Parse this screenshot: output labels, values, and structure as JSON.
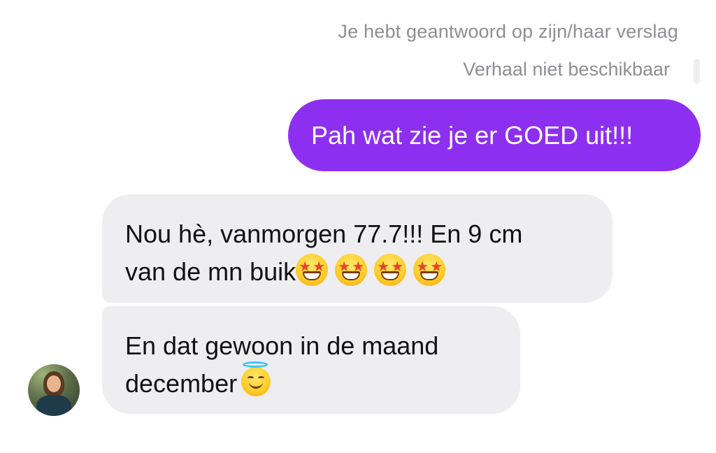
{
  "header": {
    "reply_context": "Je hebt geantwoord op zijn/haar verslag",
    "story_status": "Verhaal niet beschikbaar"
  },
  "messages": [
    {
      "direction": "outgoing",
      "text": "Pah wat zie je er GOED uit!!!"
    },
    {
      "direction": "incoming",
      "line1": "Nou hè, vanmorgen 77.7!!! En 9 cm",
      "line2": "van de mn buik",
      "emoji": [
        "🤩",
        "🤩",
        "🤩",
        "🤩"
      ]
    },
    {
      "direction": "incoming",
      "line1": "En dat gewoon in de maand",
      "line2": "december",
      "emoji": [
        "😇"
      ]
    }
  ],
  "colors": {
    "outgoing_bubble": "#8d2ff0",
    "incoming_bubble": "#eeeef0",
    "meta_text": "#8e8e93"
  },
  "icons": {
    "star_struck": "star-struck-emoji",
    "halo": "smiling-face-with-halo-emoji"
  }
}
